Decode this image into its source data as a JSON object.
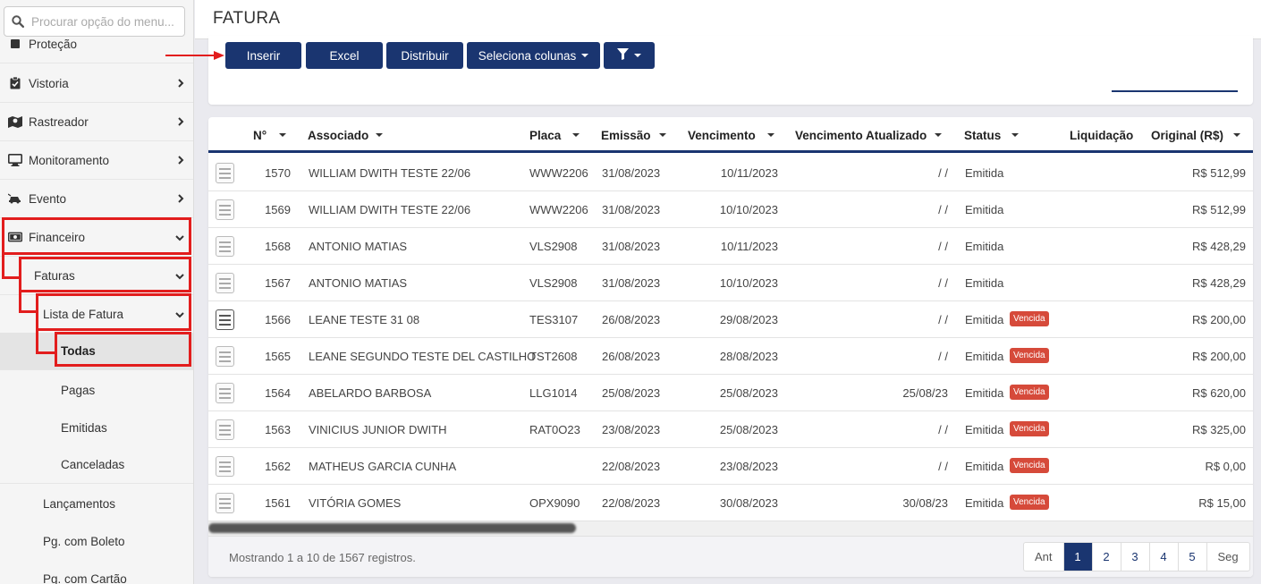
{
  "sidebar": {
    "search_placeholder": "Procurar opção do menu...",
    "items": [
      {
        "label": "Proteção"
      },
      {
        "label": "Vistoria"
      },
      {
        "label": "Rastreador"
      },
      {
        "label": "Monitoramento"
      },
      {
        "label": "Evento"
      },
      {
        "label": "Financeiro"
      },
      {
        "label": "Faturas"
      },
      {
        "label": "Lista de Fatura"
      },
      {
        "label": "Todas"
      },
      {
        "label": "Pagas"
      },
      {
        "label": "Emitidas"
      },
      {
        "label": "Canceladas"
      },
      {
        "label": "Lançamentos"
      },
      {
        "label": "Pg. com Boleto"
      },
      {
        "label": "Pg. com Cartão"
      }
    ]
  },
  "header": {
    "title": "FATURA"
  },
  "toolbar": {
    "insert": "Inserir",
    "excel": "Excel",
    "distribute": "Distribuir",
    "columns": "Seleciona colunas"
  },
  "table": {
    "columns": {
      "num": "N°",
      "associado": "Associado",
      "placa": "Placa",
      "emissao": "Emissão",
      "vencimento": "Vencimento",
      "venc_atual": "Vencimento Atualizado",
      "status": "Status",
      "liquidacao": "Liquidação",
      "original": "Original (R$)"
    },
    "badge_label": "Vencida",
    "rows": [
      {
        "num": "1570",
        "associado": "WILLIAM DWITH TESTE 22/06",
        "placa": "WWW2206",
        "emissao": "31/08/2023",
        "vencimento": "10/11/2023",
        "venc_atual": "/ /",
        "status": "Emitida",
        "badge": "",
        "original": "R$ 512,99"
      },
      {
        "num": "1569",
        "associado": "WILLIAM DWITH TESTE 22/06",
        "placa": "WWW2206",
        "emissao": "31/08/2023",
        "vencimento": "10/10/2023",
        "venc_atual": "/ /",
        "status": "Emitida",
        "badge": "",
        "original": "R$ 512,99"
      },
      {
        "num": "1568",
        "associado": "ANTONIO MATIAS",
        "placa": "VLS2908",
        "emissao": "31/08/2023",
        "vencimento": "10/11/2023",
        "venc_atual": "/ /",
        "status": "Emitida",
        "badge": "",
        "original": "R$ 428,29"
      },
      {
        "num": "1567",
        "associado": "ANTONIO MATIAS",
        "placa": "VLS2908",
        "emissao": "31/08/2023",
        "vencimento": "10/10/2023",
        "venc_atual": "/ /",
        "status": "Emitida",
        "badge": "",
        "original": "R$ 428,29"
      },
      {
        "num": "1566",
        "associado": "LEANE TESTE 31 08",
        "placa": "TES3107",
        "emissao": "26/08/2023",
        "vencimento": "29/08/2023",
        "venc_atual": "/ /",
        "status": "Emitida",
        "badge": "Vencida",
        "original": "R$ 200,00"
      },
      {
        "num": "1565",
        "associado": "LEANE SEGUNDO TESTE DEL CASTILHO",
        "placa": "TST2608",
        "emissao": "26/08/2023",
        "vencimento": "28/08/2023",
        "venc_atual": "/ /",
        "status": "Emitida",
        "badge": "Vencida",
        "original": "R$ 200,00"
      },
      {
        "num": "1564",
        "associado": "ABELARDO BARBOSA",
        "placa": "LLG1014",
        "emissao": "25/08/2023",
        "vencimento": "25/08/2023",
        "venc_atual": "25/08/23",
        "status": "Emitida",
        "badge": "Vencida",
        "original": "R$ 620,00"
      },
      {
        "num": "1563",
        "associado": "VINICIUS JUNIOR DWITH",
        "placa": "RAT0O23",
        "emissao": "23/08/2023",
        "vencimento": "25/08/2023",
        "venc_atual": "/ /",
        "status": "Emitida",
        "badge": "Vencida",
        "original": "R$ 325,00"
      },
      {
        "num": "1562",
        "associado": "MATHEUS GARCIA CUNHA",
        "placa": "",
        "emissao": "22/08/2023",
        "vencimento": "23/08/2023",
        "venc_atual": "/ /",
        "status": "Emitida",
        "badge": "Vencida",
        "original": "R$ 0,00"
      },
      {
        "num": "1561",
        "associado": "VITÓRIA GOMES",
        "placa": "OPX9090",
        "emissao": "22/08/2023",
        "vencimento": "30/08/2023",
        "venc_atual": "30/08/23",
        "status": "Emitida",
        "badge": "Vencida",
        "original": "R$ 15,00"
      }
    ]
  },
  "footer": {
    "showing": "Mostrando 1 a 10 de 1567 registros."
  },
  "pagination": {
    "prev": "Ant",
    "pages": [
      "1",
      "2",
      "3",
      "4",
      "5"
    ],
    "active": "1",
    "next": "Seg"
  },
  "colors": {
    "primary": "#1a3570",
    "danger": "#d64a3a",
    "highlight": "#e21d1d"
  }
}
